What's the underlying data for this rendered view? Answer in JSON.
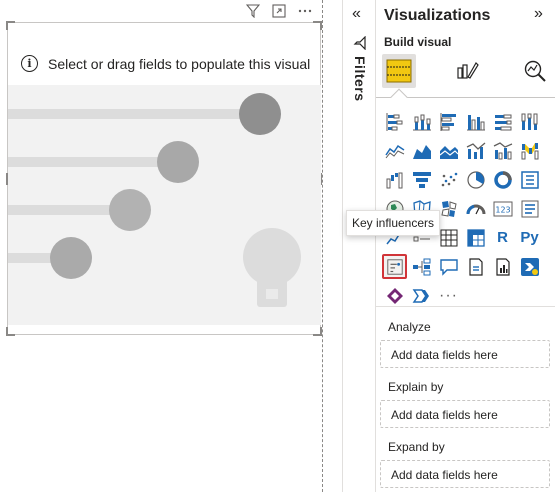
{
  "visual": {
    "info_message": "Select or drag fields to populate this visual"
  },
  "filters_strip": {
    "label": "Filters",
    "expand_glyph": "«"
  },
  "visualizations": {
    "title": "Visualizations",
    "collapse_glyph": "»",
    "build_visual_label": "Build visual",
    "tabs": [
      "build-visual-tab",
      "format-visual-tab",
      "analytics-tab"
    ],
    "icon_grid": [
      "stacked-bar-chart",
      "stacked-column-chart",
      "clustered-bar-chart",
      "clustered-column-chart",
      "100-stacked-bar-chart",
      "100-stacked-column-chart",
      "line-chart",
      "area-chart",
      "stacked-area-chart",
      "line-and-stacked-column-chart",
      "line-and-clustered-column-chart",
      "ribbon-chart",
      "waterfall-chart",
      "funnel-chart",
      "scatter-chart",
      "pie-chart",
      "donut-chart",
      "treemap",
      "map",
      "filled-map",
      "shape-map",
      "gauge",
      "card",
      "multi-row-card",
      "kpi",
      "slicer",
      "table",
      "matrix",
      "r-script-visual",
      "python-visual",
      "key-influencers",
      "decomposition-tree",
      "qa",
      "smart-narrative",
      "paginated-report",
      "power-automate",
      "power-apps",
      "goals",
      "more-visuals"
    ],
    "r_label": "R",
    "py_label": "Py",
    "more_label": "···",
    "wells": [
      {
        "label": "Analyze",
        "placeholder": "Add data fields here"
      },
      {
        "label": "Explain by",
        "placeholder": "Add data fields here"
      },
      {
        "label": "Expand by",
        "placeholder": "Add data fields here"
      }
    ]
  },
  "tooltip": {
    "text": "Key influencers"
  },
  "colors": {
    "accent_blue": "#1f6bb5",
    "selection_red": "#d13438",
    "placeholder_gray": "#f2f2f2"
  }
}
